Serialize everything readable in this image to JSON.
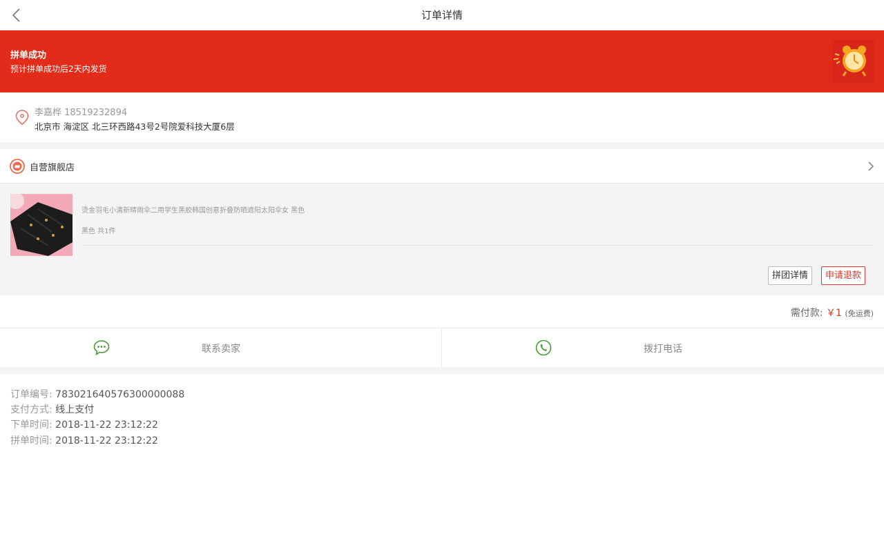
{
  "nav": {
    "title": "订单详情"
  },
  "banner": {
    "title": "拼单成功",
    "subtitle": "预计拼单成功后2天内发货",
    "color": "#e32b19"
  },
  "address": {
    "name_phone": "李嘉桦 18519232894",
    "detail": "北京市 海淀区 北三环西路43号2号院爱科技大厦6层"
  },
  "store": {
    "name": "自营旗舰店"
  },
  "goods": {
    "name": "烫金羽毛小清新晴雨伞二用学生黑胶韩国创意折叠防晒遮阳太阳伞女 黑色",
    "spec": "黑色 共1件",
    "btn_detail": "拼团详情",
    "btn_refund": "申请退款"
  },
  "pay": {
    "label": "需付款:",
    "amount": "￥1",
    "shipping": "(免运费)"
  },
  "contact": {
    "seller": "联系卖家",
    "phone": "拨打电话",
    "icon_color": "#4a9a3a"
  },
  "order": {
    "no_label": "订单编号:",
    "no_value": "783021640576300000088",
    "method_label": "支付方式:",
    "method_value": "线上支付",
    "created_label": "下单时间:",
    "created_value": "2018-11-22 23:12:22",
    "group_label": "拼单时间:",
    "group_value": "2018-11-22 23:12:22"
  },
  "icons": [
    "back-icon",
    "alarm-clock-icon",
    "location-pin-icon",
    "store-logo-icon",
    "chevron-right-icon",
    "chat-bubble-icon",
    "phone-icon"
  ]
}
